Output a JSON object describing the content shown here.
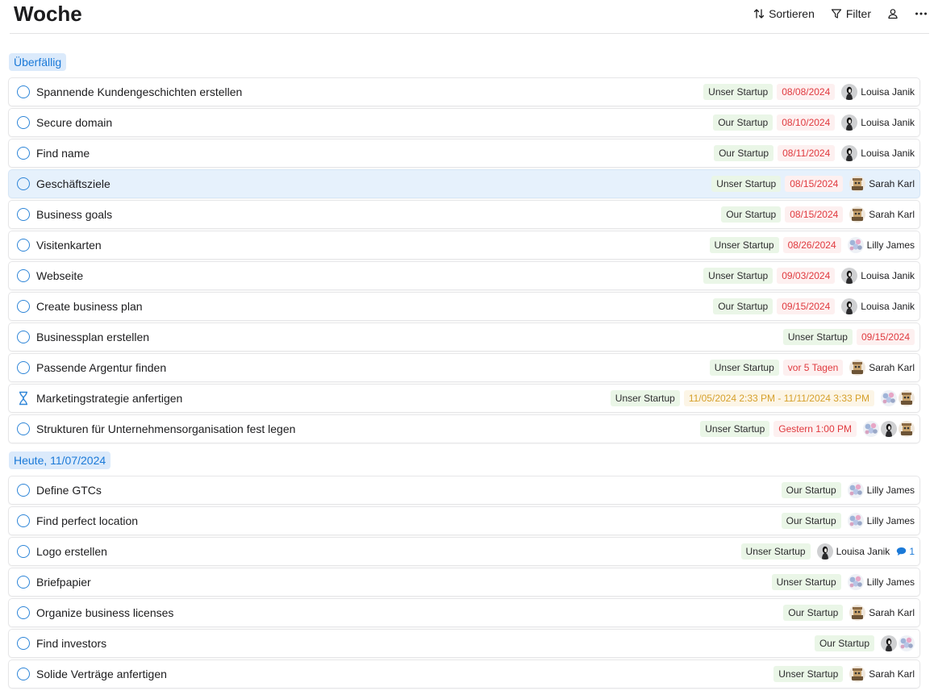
{
  "header": {
    "title": "Woche",
    "sort_label": "Sortieren",
    "filter_label": "Filter"
  },
  "sections": [
    {
      "label": "Überfällig",
      "tasks": [
        {
          "title": "Spannende Kundengeschichten erstellen",
          "project": "Unser Startup",
          "due": "08/08/2024",
          "assignees": [
            "louisa"
          ],
          "assignee_name": "Louisa Janik"
        },
        {
          "title": "Secure domain",
          "project": "Our Startup",
          "due": "08/10/2024",
          "assignees": [
            "louisa"
          ],
          "assignee_name": "Louisa Janik"
        },
        {
          "title": "Find name",
          "project": "Our Startup",
          "due": "08/11/2024",
          "assignees": [
            "louisa"
          ],
          "assignee_name": "Louisa Janik"
        },
        {
          "title": "Geschäftsziele",
          "project": "Unser Startup",
          "due": "08/15/2024",
          "assignees": [
            "sarah"
          ],
          "assignee_name": "Sarah Karl",
          "selected": true
        },
        {
          "title": "Business goals",
          "project": "Our Startup",
          "due": "08/15/2024",
          "assignees": [
            "sarah"
          ],
          "assignee_name": "Sarah Karl"
        },
        {
          "title": "Visitenkarten",
          "project": "Unser Startup",
          "due": "08/26/2024",
          "assignees": [
            "lilly"
          ],
          "assignee_name": "Lilly James"
        },
        {
          "title": "Webseite",
          "project": "Unser Startup",
          "due": "09/03/2024",
          "assignees": [
            "louisa"
          ],
          "assignee_name": "Louisa Janik"
        },
        {
          "title": "Create business plan",
          "project": "Our Startup",
          "due": "09/15/2024",
          "assignees": [
            "louisa"
          ],
          "assignee_name": "Louisa Janik"
        },
        {
          "title": "Businessplan erstellen",
          "project": "Unser Startup",
          "due": "09/15/2024",
          "assignees": []
        },
        {
          "title": "Passende Argentur finden",
          "project": "Unser Startup",
          "due": "vor 5 Tagen",
          "assignees": [
            "sarah"
          ],
          "assignee_name": "Sarah Karl"
        },
        {
          "title": "Marketingstrategie anfertigen",
          "project": "Unser Startup",
          "due": "11/05/2024 2:33 PM - 11/11/2024 3:33 PM",
          "due_style": "warn",
          "status": "in-progress",
          "assignees": [
            "lilly",
            "sarah"
          ]
        },
        {
          "title": "Strukturen für Unternehmensorganisation fest legen",
          "project": "Unser Startup",
          "due": "Gestern 1:00 PM",
          "assignees": [
            "lilly",
            "louisa",
            "sarah"
          ]
        }
      ]
    },
    {
      "label": "Heute, 11/07/2024",
      "tasks": [
        {
          "title": "Define GTCs",
          "project": "Our Startup",
          "assignees": [
            "lilly"
          ],
          "assignee_name": "Lilly James"
        },
        {
          "title": "Find perfect location",
          "project": "Our Startup",
          "assignees": [
            "lilly"
          ],
          "assignee_name": "Lilly James"
        },
        {
          "title": "Logo erstellen",
          "project": "Unser Startup",
          "assignees": [
            "louisa"
          ],
          "assignee_name": "Louisa Janik",
          "comments": "1"
        },
        {
          "title": "Briefpapier",
          "project": "Unser Startup",
          "assignees": [
            "lilly"
          ],
          "assignee_name": "Lilly James"
        },
        {
          "title": "Organize business licenses",
          "project": "Our Startup",
          "assignees": [
            "sarah"
          ],
          "assignee_name": "Sarah Karl"
        },
        {
          "title": "Find investors",
          "project": "Our Startup",
          "assignees": [
            "louisa",
            "lilly"
          ]
        },
        {
          "title": "Solide Verträge anfertigen",
          "project": "Unser Startup",
          "assignees": [
            "sarah"
          ],
          "assignee_name": "Sarah Karl"
        }
      ]
    }
  ],
  "colors": {
    "accent": "#1a79d8",
    "overdue": "#e0393e",
    "warning": "#d6a02b",
    "project_bg": "#eaf6e7",
    "selected_row_bg": "#e6f1fc"
  },
  "icons": {
    "sort": "sort-arrows-icon",
    "filter": "filter-funnel-icon",
    "person": "person-icon",
    "more": "more-dots-icon",
    "open_task": "circle-checkbox-icon",
    "in_progress": "hourglass-icon",
    "comment": "comment-bubble-icon"
  }
}
